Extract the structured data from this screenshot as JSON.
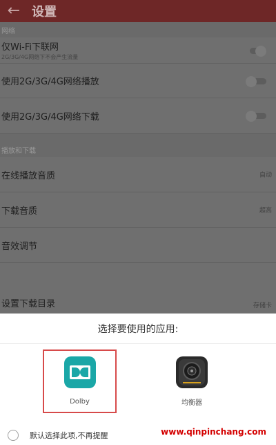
{
  "header": {
    "back_icon": "arrow-left-icon",
    "title": "设置"
  },
  "settings": {
    "sections": [
      {
        "title": "网络",
        "rows": [
          {
            "title": "仅Wi-Fi下联网",
            "subtitle": "2G/3G/4G网络下不会产生流量",
            "toggle": "off"
          },
          {
            "title": "使用2G/3G/4G网络播放",
            "toggle": "off"
          },
          {
            "title": "使用2G/3G/4G网络下载",
            "toggle": "off"
          }
        ]
      },
      {
        "title": "播放和下载",
        "rows": [
          {
            "title": "在线播放音质",
            "value": "自动"
          },
          {
            "title": "下载音质",
            "value": "超高"
          },
          {
            "title": "音效调节"
          },
          {
            "title": "设置下载目录",
            "value": "存储卡"
          }
        ]
      }
    ]
  },
  "sheet": {
    "title": "选择要使用的应用:",
    "apps": [
      {
        "label": "Dolby",
        "icon": "dolby-logo-icon",
        "selected": true
      },
      {
        "label": "均衡器",
        "icon": "speaker-icon",
        "selected": false
      }
    ],
    "remember": "默认选择此项,不再提醒"
  },
  "watermark": "www.qinpinchang.com",
  "colors": {
    "header": "#6e2727",
    "dim_overlay": "#6f6f6f",
    "dolby": "#1aa7a7",
    "highlight": "#d74a4a"
  }
}
